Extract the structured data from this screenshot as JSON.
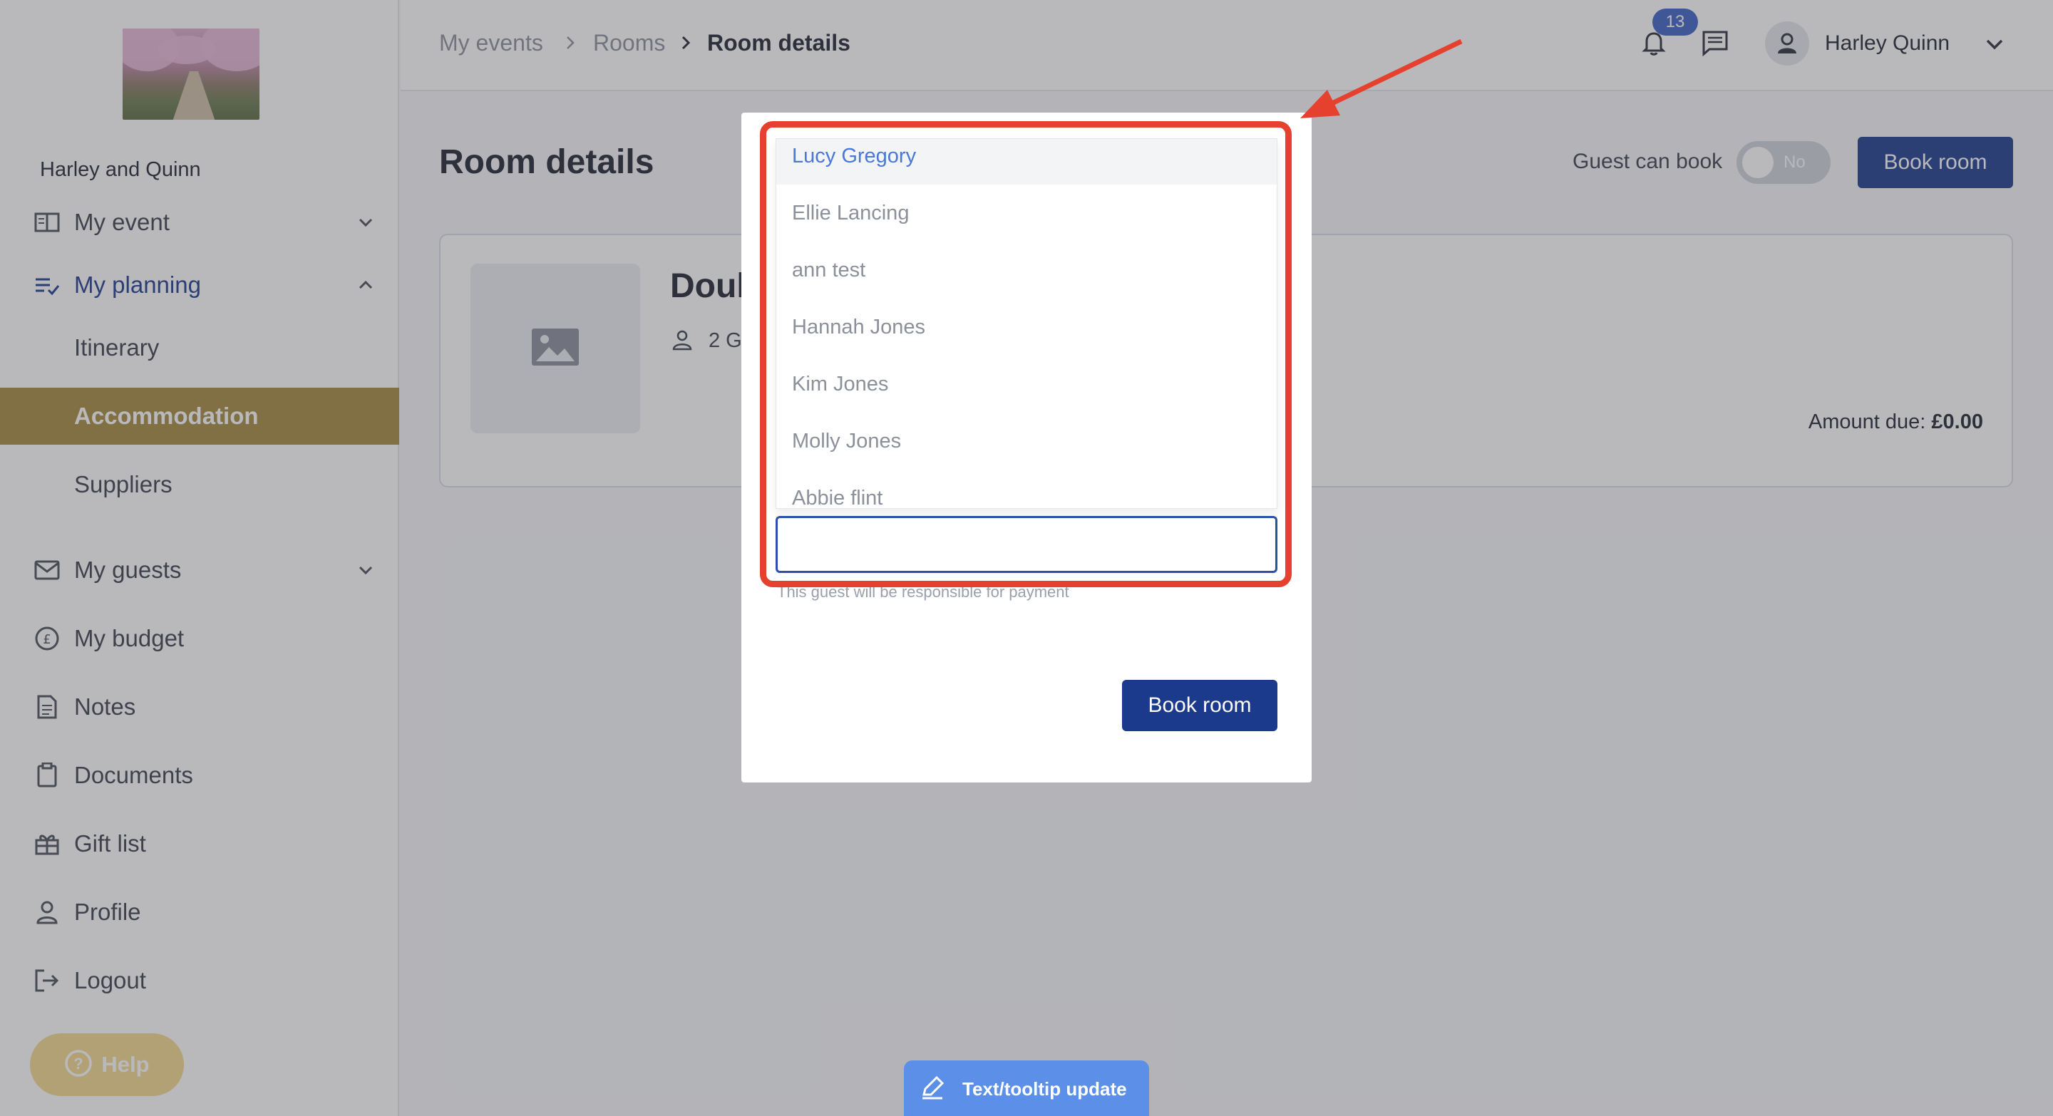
{
  "sidebar": {
    "event_name": "Harley and Quinn",
    "nav": {
      "my_event": "My event",
      "my_planning": "My planning",
      "itinerary": "Itinerary",
      "accommodation": "Accommodation",
      "suppliers": "Suppliers",
      "my_guests": "My guests",
      "my_budget": "My budget",
      "notes": "Notes",
      "documents": "Documents",
      "gift_list": "Gift list",
      "profile": "Profile",
      "logout": "Logout"
    },
    "help_label": "Help"
  },
  "topbar": {
    "breadcrumb": {
      "events": "My events",
      "rooms": "Rooms",
      "current": "Room details"
    },
    "notification_count": "13",
    "user_name": "Harley Quinn"
  },
  "page": {
    "title": "Room details",
    "guest_can_book_label": "Guest can book",
    "guest_can_book_value": "No",
    "book_room_label": "Book room",
    "room": {
      "name": "Doul",
      "guests": "2 G",
      "amount_due_label": "Amount due:",
      "amount_due_value": "£0.00"
    }
  },
  "modal": {
    "options": [
      "Lucy Gregory",
      "Ellie Lancing",
      "ann test",
      "Hannah Jones",
      "Kim Jones",
      "Molly Jones",
      "Abbie flint"
    ],
    "highlighted_option": "Lucy Gregory",
    "input_value": "",
    "helper_text": "This guest will be responsible for payment",
    "book_button_label": "Book room"
  },
  "floating_button": {
    "label": "Text/tooltip update"
  },
  "colors": {
    "primary": "#1c3a8c",
    "accent_gold": "#a58a3c",
    "highlight_red": "#e5412e",
    "pill_blue": "#5b8fe8"
  }
}
